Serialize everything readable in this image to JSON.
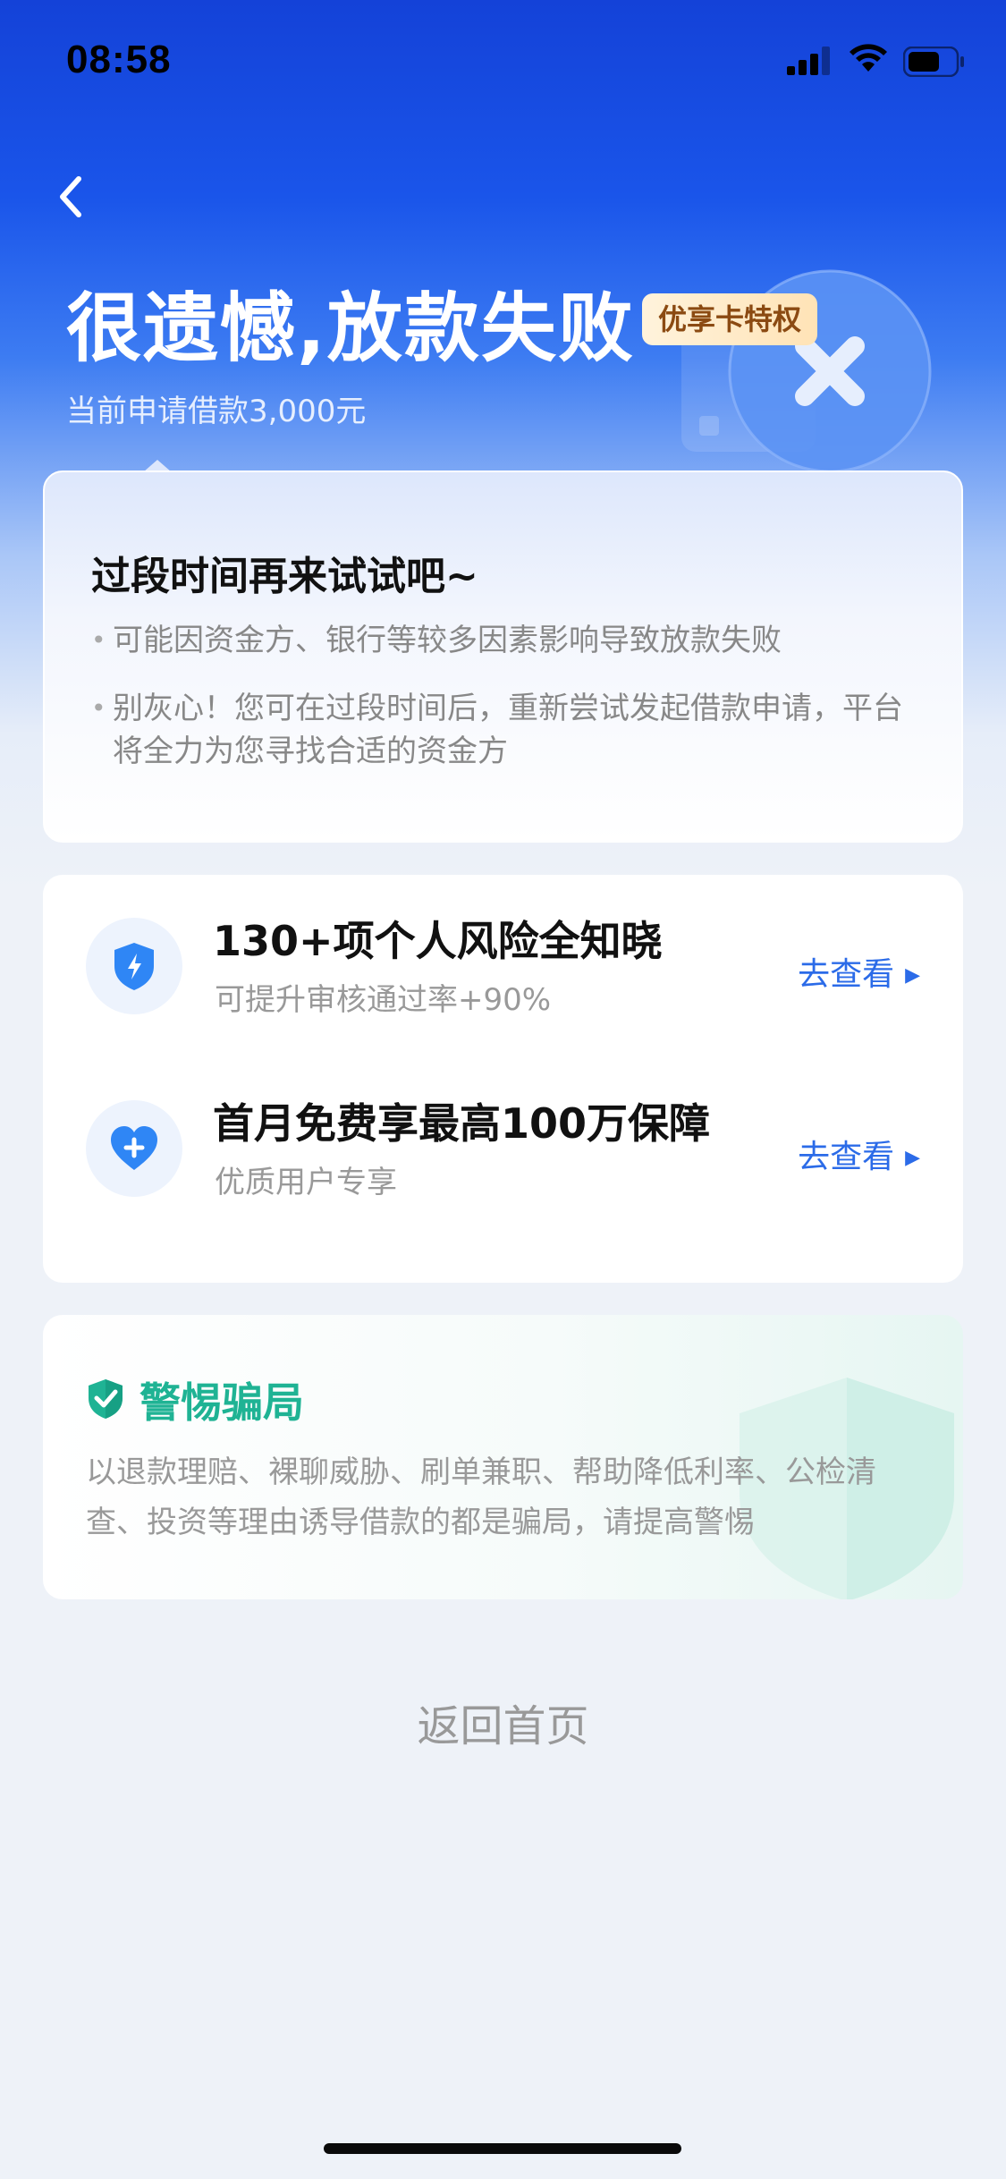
{
  "status_bar": {
    "time": "08:58"
  },
  "header": {
    "title": "很遗憾,放款失败",
    "privilege_badge": "优享卡特权",
    "subtitle": "当前申请借款3,000元"
  },
  "notice_card": {
    "heading": "过段时间再来试试吧~",
    "bullets": [
      "可能因资金方、银行等较多因素影响导致放款失败",
      "别灰心！您可在过段时间后，重新尝试发起借款申请，平台将全力为您寻找合适的资金方"
    ]
  },
  "service_card": {
    "items": [
      {
        "icon": "shield-lightning-icon",
        "title": "130+项个人风险全知晓",
        "subtitle": "可提升审核通过率+90%",
        "link": "去查看"
      },
      {
        "icon": "heart-plus-icon",
        "title": "首月免费享最高100万保障",
        "subtitle": "优质用户专享",
        "link": "去查看"
      }
    ]
  },
  "fraud_warning": {
    "title": "警惕骗局",
    "text": "以退款理赔、裸聊威胁、刷单兼职、帮助降低利率、公检清查、投资等理由诱导借款的都是骗局，请提高警惕"
  },
  "footer": {
    "home_button": "返回首页"
  },
  "colors": {
    "brand_blue": "#1a55ea",
    "link_blue": "#2b6be8",
    "warning_green": "#1fb394",
    "badge_text": "#8b4a12"
  }
}
